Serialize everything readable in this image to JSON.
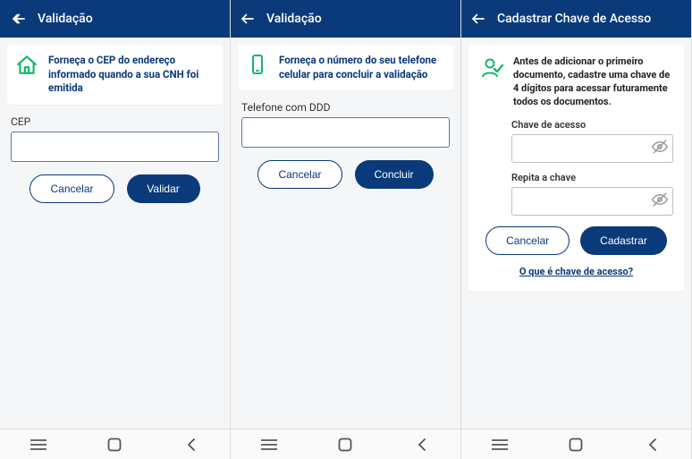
{
  "screen1": {
    "header": {
      "title": "Validação"
    },
    "banner": {
      "text": "Forneça o CEP do endereço informado quando a sua CNH foi emitida"
    },
    "form": {
      "label": "CEP",
      "value": ""
    },
    "buttons": {
      "cancel": "Cancelar",
      "primary": "Validar"
    }
  },
  "screen2": {
    "header": {
      "title": "Validação"
    },
    "banner": {
      "text": "Forneça o número do seu telefone celular para concluir a validação"
    },
    "form": {
      "label": "Telefone com DDD",
      "value": ""
    },
    "buttons": {
      "cancel": "Cancelar",
      "primary": "Concluir"
    }
  },
  "screen3": {
    "header": {
      "title": "Cadastrar Chave de Acesso"
    },
    "banner": {
      "text": "Antes de adicionar o primeiro documento, cadastre uma chave de 4 dígitos para acessar futuramente todos os documentos."
    },
    "form": {
      "label1": "Chave de acesso",
      "value1": "",
      "label2": "Repita a chave",
      "value2": ""
    },
    "buttons": {
      "cancel": "Cancelar",
      "primary": "Cadastrar"
    },
    "link": "O que é chave de acesso?"
  },
  "colors": {
    "primary": "#0a3a7a",
    "accent_green": "#12b76a"
  }
}
